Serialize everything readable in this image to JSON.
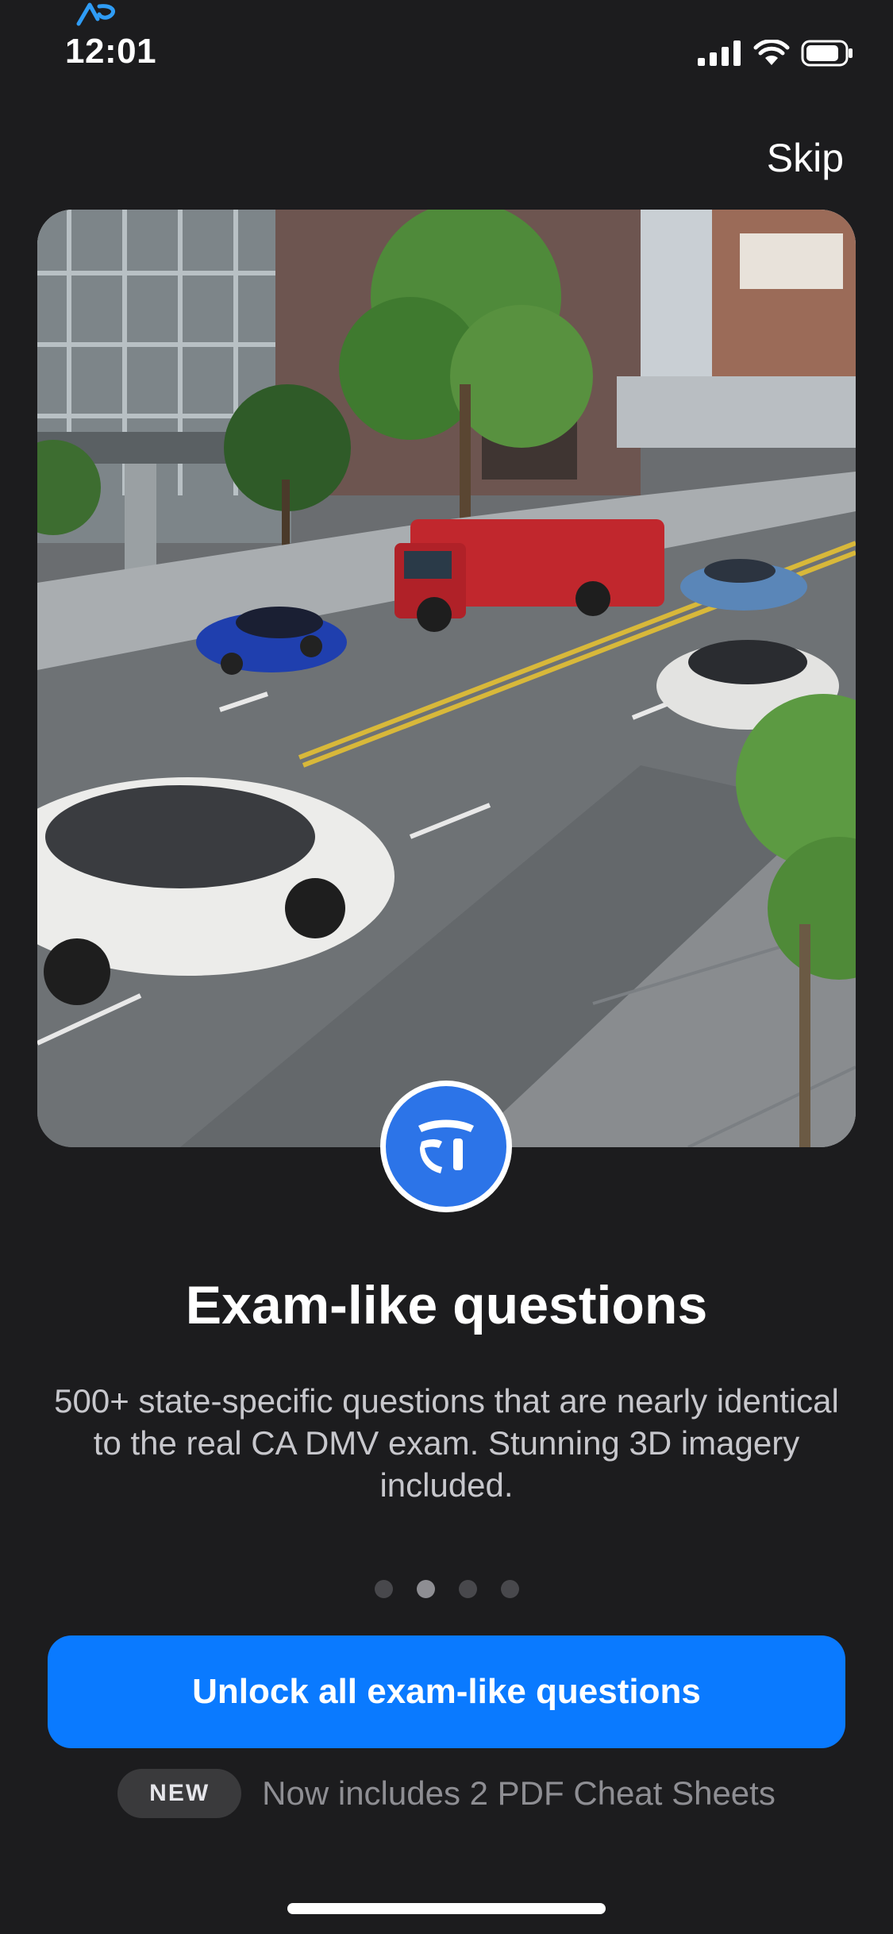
{
  "status_bar": {
    "time": "12:01",
    "icons": [
      "app-logo-icon",
      "signal-icon",
      "wifi-icon",
      "battery-icon"
    ]
  },
  "header": {
    "skip_label": "Skip"
  },
  "hero": {
    "image_subject": "3D street scene with fire truck and cars",
    "badge_icon": "shield-logo-icon"
  },
  "content": {
    "title": "Exam-like questions",
    "description": "500+ state-specific questions that are nearly identical to the real CA DMV exam. Stunning 3D imagery included."
  },
  "pagination": {
    "total": 4,
    "active": 2
  },
  "cta": {
    "label": "Unlock all exam-like questions"
  },
  "promo": {
    "badge": "NEW",
    "text": "Now includes 2 PDF Cheat Sheets"
  },
  "colors": {
    "background": "#1c1c1e",
    "primary_button": "#0a7aff",
    "badge_blue": "#2c74e8",
    "muted_text": "#8e8e93"
  }
}
